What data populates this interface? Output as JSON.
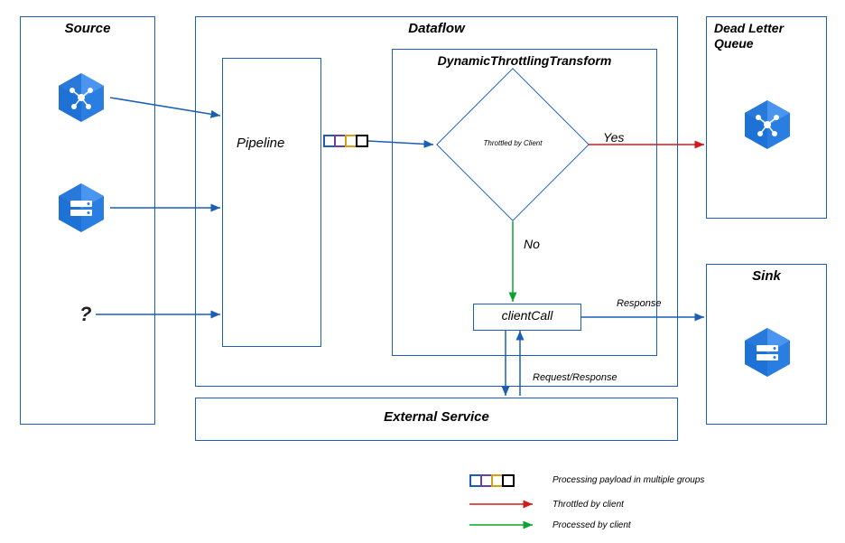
{
  "source": {
    "title": "Source",
    "question": "?"
  },
  "dataflow": {
    "title": "Dataflow"
  },
  "pipeline": {
    "label": "Pipeline"
  },
  "transform": {
    "title": "DynamicThrottlingTransform"
  },
  "decision": {
    "label": "Throttled by Client",
    "yes": "Yes",
    "no": "No"
  },
  "clientcall": {
    "label": "clientCall"
  },
  "external": {
    "title": "External Service"
  },
  "req_resp": "Request/Response",
  "response": "Response",
  "dlq": {
    "title": "Dead Letter Queue"
  },
  "sink": {
    "title": "Sink"
  },
  "legend": {
    "payload": "Processing payload in multiple groups",
    "throttled": "Throttled by client",
    "processed": "Processed by client"
  },
  "colors": {
    "blue": "#1a5fb4",
    "red": "#d11a1a",
    "green": "#0ea32e",
    "purple": "#6b3fa0",
    "gold": "#d4a017",
    "black": "#000"
  }
}
